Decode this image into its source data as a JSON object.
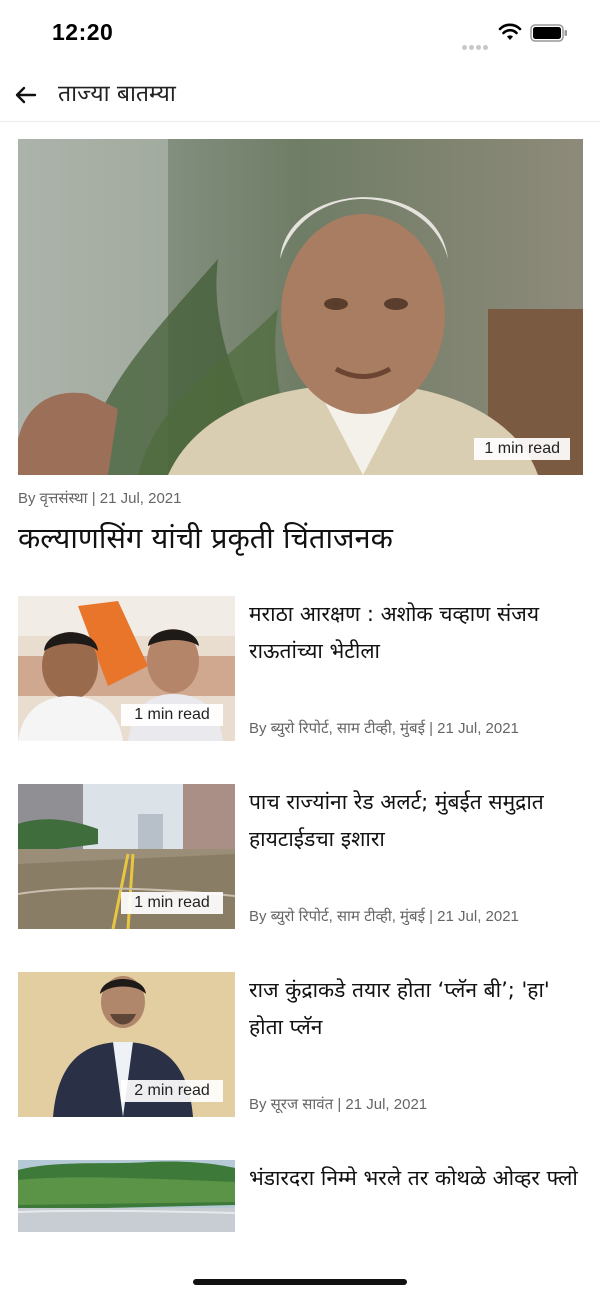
{
  "status_bar": {
    "time": "12:20"
  },
  "header": {
    "title": "ताज्या बातम्या"
  },
  "hero": {
    "read_time": "1 min read",
    "byline": "By वृत्तसंस्था | 21 Jul, 2021",
    "headline": "कल्याणसिंग यांची प्रकृती चिंताजनक"
  },
  "articles": [
    {
      "title": "मराठा आरक्षण : अशोक चव्हाण संजय राऊतांच्या भेटीला",
      "read_time": "1 min read",
      "byline": "By ब्युरो रिपोर्ट, साम टीव्ही, मुंबई | 21 Jul, 2021"
    },
    {
      "title": "पाच राज्यांना रेड अलर्ट; मुंबईत समुद्रात हायटाईडचा इशारा",
      "read_time": "1 min read",
      "byline": "By ब्युरो रिपोर्ट, साम टीव्ही, मुंबई | 21 Jul, 2021"
    },
    {
      "title": "राज कुंद्राकडे तयार होता ‘प्लॅन बी’; 'हा' होता प्लॅन",
      "read_time": "2 min read",
      "byline": "By सूरज सावंत | 21 Jul, 2021"
    },
    {
      "title": "भंडारदरा निम्मे भरले तर कोथळे ओव्हर फ्लो",
      "read_time": "",
      "byline": ""
    }
  ]
}
